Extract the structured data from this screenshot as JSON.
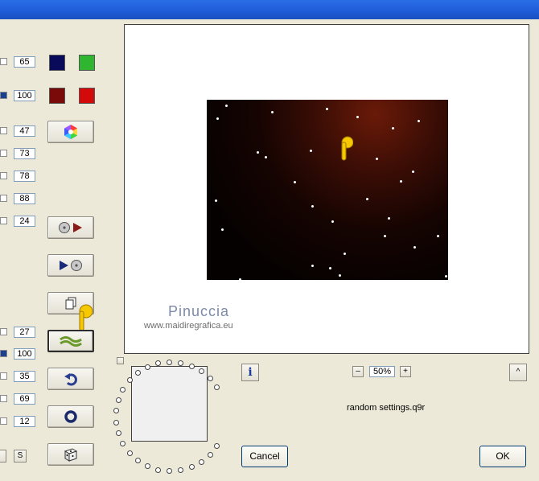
{
  "window": {
    "title": ""
  },
  "params_top": [
    {
      "value": "65",
      "checked": false
    },
    {
      "value": "100",
      "checked": true
    },
    {
      "value": "47",
      "checked": false
    },
    {
      "value": "73",
      "checked": false
    },
    {
      "value": "78",
      "checked": false
    },
    {
      "value": "88",
      "checked": false
    },
    {
      "value": "24",
      "checked": false
    }
  ],
  "params_bottom": [
    {
      "value": "27",
      "checked": false
    },
    {
      "value": "100",
      "checked": true
    },
    {
      "value": "35",
      "checked": false
    },
    {
      "value": "69",
      "checked": false
    },
    {
      "value": "12",
      "checked": false
    }
  ],
  "colors": {
    "navy": "#0a0a5a",
    "green": "#2fb52f",
    "darkred": "#7a0a0a",
    "red": "#d40a0a"
  },
  "buttons": {
    "color_wheel": "color-wheel-icon",
    "load_preset": "load-preset-icon",
    "save_preset": "save-preset-icon",
    "copy": "copy-icon",
    "randomize_wave": "wave-icon",
    "reset": "undo-icon",
    "circle": "ring-icon",
    "dice": "dice-icon",
    "s_label": "S"
  },
  "watermark": {
    "name": "Pinuccia",
    "url": "www.maidiregrafica.eu"
  },
  "zoom": {
    "minus": "–",
    "value": "50%",
    "plus": "+"
  },
  "info_label": "i",
  "scroll_up": "^",
  "settings_file": "random settings.q9r",
  "actions": {
    "cancel": "Cancel",
    "ok": "OK"
  }
}
